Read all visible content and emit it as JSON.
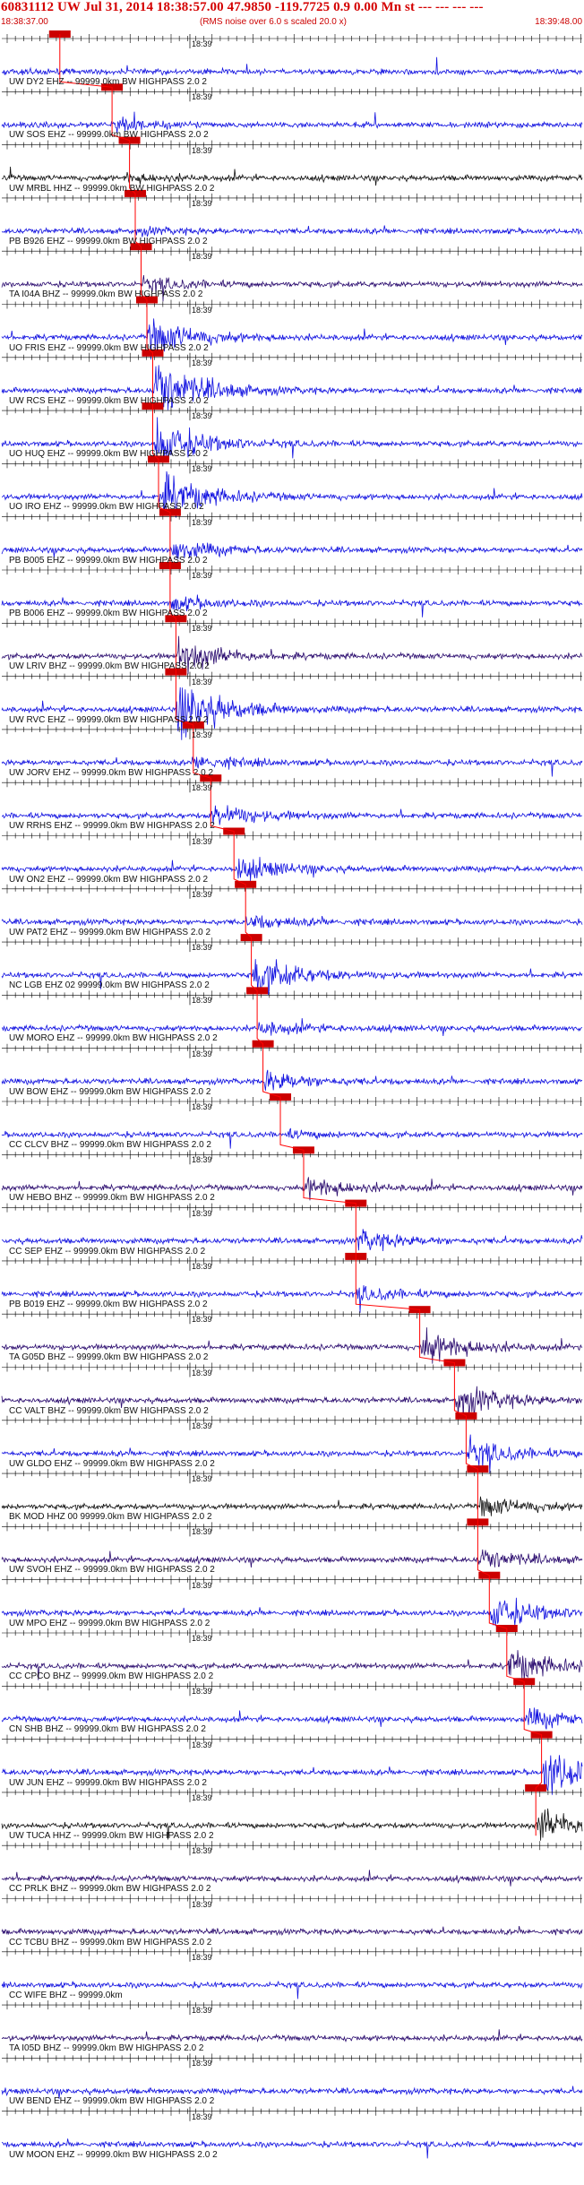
{
  "header": {
    "title": "60831112 UW Jul 31, 2014 18:38:57.00   47.9850 -119.7725  0.9 0.00 Mn st --- --- --- ---",
    "start_time": "18:38:37.00",
    "note": "(RMS noise over 6.0 s scaled 20.0 x)",
    "end_time": "18:39:48.00"
  },
  "minute_label": "18:39",
  "colors": {
    "title": "#d40000",
    "trace_blue": "#1010e0",
    "trace_black": "#111111",
    "trace_purple": "#2a0b6e",
    "pick_line": "#ff0000",
    "pick_box": "#cc0000"
  },
  "traces": [
    {
      "label": "UW DY2 EHZ -- 99999.0km BW  HIGHPASS  2.0  2",
      "color": "blue",
      "pick": 0.1,
      "arrival": 0.0,
      "event": 0.03
    },
    {
      "label": "UW SOS EHZ -- 99999.0km BW  HIGHPASS  2.0  2",
      "color": "blue",
      "pick": 0.19,
      "arrival": 0.19,
      "event": 0.15
    },
    {
      "label": "UW MRBL HHZ -- 99999.0km BW  HIGHPASS  2.0  2",
      "color": "black",
      "pick": 0.22,
      "arrival": 0.21,
      "event": 0.12
    },
    {
      "label": "PB B926 EHZ -- 99999.0km BW  HIGHPASS  2.0  2",
      "color": "blue",
      "pick": 0.23,
      "arrival": 0.23,
      "event": 0.08
    },
    {
      "label": "TA I04A BHZ -- 99999.0km BW  HIGHPASS  2.0  2",
      "color": "purple",
      "pick": 0.24,
      "arrival": 0.24,
      "event": 0.2
    },
    {
      "label": "UO FRIS EHZ -- 99999.0km BW  HIGHPASS  2.0  2",
      "color": "blue",
      "pick": 0.25,
      "arrival": 0.25,
      "event": 0.55
    },
    {
      "label": "UW RCS EHZ -- 99999.0km BW  HIGHPASS  2.0  2",
      "color": "blue",
      "pick": 0.26,
      "arrival": 0.26,
      "event": 0.9
    },
    {
      "label": "UO HUQ EHZ -- 99999.0km BW  HIGHPASS  2.0  2",
      "color": "blue",
      "pick": 0.26,
      "arrival": 0.26,
      "event": 0.7
    },
    {
      "label": "UO IRO EHZ -- 99999.0km BW  HIGHPASS  2.0  2",
      "color": "blue",
      "pick": 0.27,
      "arrival": 0.27,
      "event": 0.7
    },
    {
      "label": "PB B005 EHZ -- 99999.0km BW  HIGHPASS  2.0  2",
      "color": "blue",
      "pick": 0.29,
      "arrival": 0.29,
      "event": 0.3
    },
    {
      "label": "PB B006 EHZ -- 99999.0km BW  HIGHPASS  2.0  2",
      "color": "blue",
      "pick": 0.29,
      "arrival": 0.29,
      "event": 0.2
    },
    {
      "label": "UW LRIV BHZ -- 99999.0km BW  HIGHPASS  2.0  2",
      "color": "purple",
      "pick": 0.3,
      "arrival": 0.3,
      "event": 0.5
    },
    {
      "label": "UW RVC EHZ -- 99999.0km BW  HIGHPASS  2.0  2",
      "color": "blue",
      "pick": 0.3,
      "arrival": 0.3,
      "event": 0.9
    },
    {
      "label": "UW JORV EHZ -- 99999.0km BW  HIGHPASS  2.0  2",
      "color": "blue",
      "pick": 0.33,
      "arrival": 0.33,
      "event": 0.2
    },
    {
      "label": "UW RRHS EHZ -- 99999.0km BW  HIGHPASS  2.0  2",
      "color": "blue",
      "pick": 0.36,
      "arrival": 0.36,
      "event": 0.35
    },
    {
      "label": "UW ON2 EHZ -- 99999.0km BW  HIGHPASS  2.0  2",
      "color": "blue",
      "pick": 0.4,
      "arrival": 0.4,
      "event": 0.35
    },
    {
      "label": "UW PAT2 EHZ -- 99999.0km BW  HIGHPASS  2.0  2",
      "color": "blue",
      "pick": 0.42,
      "arrival": 0.42,
      "event": 0.2
    },
    {
      "label": "NC LGB EHZ 02 99999.0km BW  HIGHPASS  2.0  2",
      "color": "blue",
      "pick": 0.43,
      "arrival": 0.43,
      "event": 0.6
    },
    {
      "label": "UW MORO EHZ -- 99999.0km BW  HIGHPASS  2.0  2",
      "color": "blue",
      "pick": 0.44,
      "arrival": 0.44,
      "event": 0.2
    },
    {
      "label": "UW BOW EHZ -- 99999.0km BW  HIGHPASS  2.0  2",
      "color": "blue",
      "pick": 0.45,
      "arrival": 0.45,
      "event": 0.3
    },
    {
      "label": "CC CLCV BHZ -- 99999.0km BW  HIGHPASS  2.0  2",
      "color": "blue",
      "pick": 0.48,
      "arrival": 0.48,
      "event": 0.1
    },
    {
      "label": "UW HEBO BHZ -- 99999.0km BW  HIGHPASS  2.0  2",
      "color": "purple",
      "pick": 0.52,
      "arrival": 0.52,
      "event": 0.3
    },
    {
      "label": "CC SEP EHZ -- 99999.0km BW  HIGHPASS  2.0  2",
      "color": "blue",
      "pick": 0.61,
      "arrival": 0.61,
      "event": 0.3
    },
    {
      "label": "PB B019 EHZ -- 99999.0km BW  HIGHPASS  2.0  2",
      "color": "blue",
      "pick": 0.61,
      "arrival": 0.61,
      "event": 0.2
    },
    {
      "label": "TA G05D BHZ -- 99999.0km BW  HIGHPASS  2.0  2",
      "color": "purple",
      "pick": 0.72,
      "arrival": 0.72,
      "event": 0.5
    },
    {
      "label": "CC VALT BHZ -- 99999.0km BW  HIGHPASS  2.0  2",
      "color": "purple",
      "pick": 0.78,
      "arrival": 0.78,
      "event": 0.5
    },
    {
      "label": "UW GLDO EHZ -- 99999.0km BW  HIGHPASS  2.0  2",
      "color": "blue",
      "pick": 0.8,
      "arrival": 0.8,
      "event": 0.4
    },
    {
      "label": "BK MOD HHZ 00 99999.0km BW  HIGHPASS  2.0  2",
      "color": "black",
      "pick": 0.82,
      "arrival": 0.82,
      "event": 0.3
    },
    {
      "label": "UW SVOH EHZ -- 99999.0km BW  HIGHPASS  2.0  2",
      "color": "purple",
      "pick": 0.82,
      "arrival": 0.82,
      "event": 0.3
    },
    {
      "label": "UW MPO EHZ -- 99999.0km BW  HIGHPASS  2.0  2",
      "color": "blue",
      "pick": 0.84,
      "arrival": 0.84,
      "event": 0.5
    },
    {
      "label": "CC CPCO BHZ -- 99999.0km BW  HIGHPASS  2.0  2",
      "color": "purple",
      "pick": 0.87,
      "arrival": 0.87,
      "event": 0.5
    },
    {
      "label": "CN SHB BHZ -- 99999.0km BW  HIGHPASS  2.0  2",
      "color": "blue",
      "pick": 0.9,
      "arrival": 0.9,
      "event": 0.3
    },
    {
      "label": "UW JUN EHZ -- 99999.0km BW  HIGHPASS  2.0  2",
      "color": "blue",
      "pick": 0.93,
      "arrival": 0.93,
      "event": 0.8
    },
    {
      "label": "UW TUCA HHZ -- 99999.0km BW  HIGHPASS  2.0  2",
      "color": "black",
      "pick": 0.92,
      "arrival": 0.92,
      "event": 0.5
    },
    {
      "label": "CC PRLK BHZ -- 99999.0km BW  HIGHPASS  2.0  2",
      "color": "purple",
      "pick": null,
      "arrival": null,
      "event": 0.0
    },
    {
      "label": "CC TCBU BHZ -- 99999.0km BW  HIGHPASS  2.0  2",
      "color": "purple",
      "pick": null,
      "arrival": null,
      "event": 0.0
    },
    {
      "label": "CC WIFE BHZ -- 99999.0km",
      "color": "blue",
      "pick": null,
      "arrival": null,
      "event": 0.0
    },
    {
      "label": "TA I05D BHZ -- 99999.0km BW  HIGHPASS  2.0  2",
      "color": "purple",
      "pick": null,
      "arrival": null,
      "event": 0.0
    },
    {
      "label": "UW BEND EHZ -- 99999.0km BW  HIGHPASS  2.0  2",
      "color": "blue",
      "pick": null,
      "arrival": null,
      "event": 0.0
    },
    {
      "label": "UW MOON EHZ -- 99999.0km BW  HIGHPASS  2.0  2",
      "color": "blue",
      "pick": null,
      "arrival": null,
      "event": 0.0
    }
  ]
}
